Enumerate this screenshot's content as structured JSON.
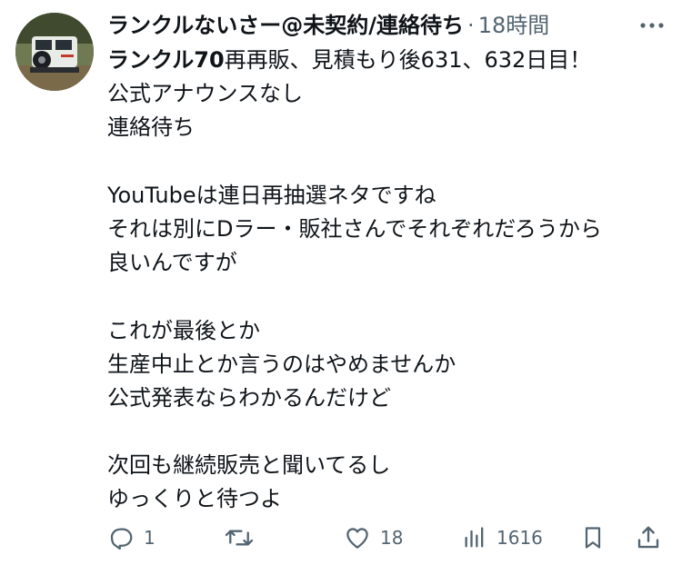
{
  "post": {
    "author": {
      "display_name": "ランクルないさー@未契約/連絡待ち",
      "avatar_icon": "avatar-jeep-icon"
    },
    "separator": "·",
    "timestamp": "18時間",
    "more_icon": "more-dots-icon",
    "text_lines": [
      {
        "bold": "ランクル70",
        "normal": "再再販、見積もり後631、632日目！"
      },
      {
        "bold": "",
        "normal": "公式アナウンスなし"
      },
      {
        "bold": "",
        "normal": "連絡待ち"
      },
      {
        "bold": "",
        "normal": ""
      },
      {
        "bold": "",
        "normal": "YouTubeは連日再抽選ネタですね"
      },
      {
        "bold": "",
        "normal": "それは別にDラー・販社さんでそれぞれだろうから"
      },
      {
        "bold": "",
        "normal": "良いんですが"
      },
      {
        "bold": "",
        "normal": ""
      },
      {
        "bold": "",
        "normal": "これが最後とか"
      },
      {
        "bold": "",
        "normal": "生産中止とか言うのはやめませんか"
      },
      {
        "bold": "",
        "normal": "公式発表ならわかるんだけど"
      },
      {
        "bold": "",
        "normal": ""
      },
      {
        "bold": "",
        "normal": "次回も継続販売と聞いてるし"
      },
      {
        "bold": "",
        "normal": "ゆっくりと待つよ"
      }
    ]
  },
  "actions": {
    "reply": {
      "icon": "reply-icon",
      "count": "1"
    },
    "retweet": {
      "icon": "retweet-icon",
      "count": ""
    },
    "like": {
      "icon": "heart-icon",
      "count": "18"
    },
    "views": {
      "icon": "views-icon",
      "count": "1616"
    },
    "bookmark": {
      "icon": "bookmark-icon"
    },
    "share": {
      "icon": "share-icon"
    }
  },
  "colors": {
    "text": "#0f1419",
    "secondary": "#536471"
  }
}
